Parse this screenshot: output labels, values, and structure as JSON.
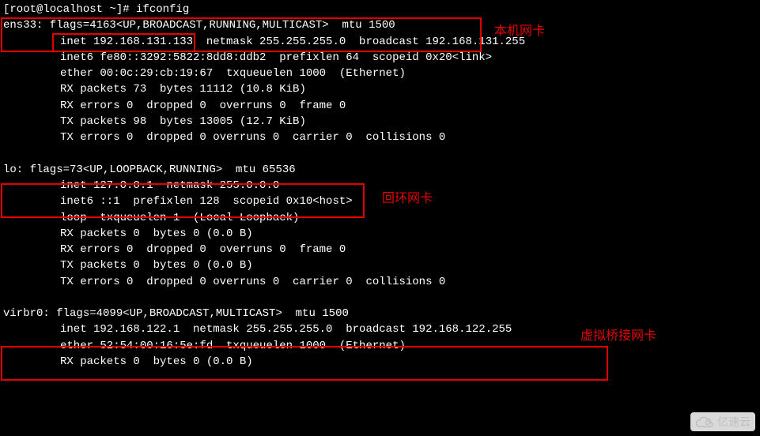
{
  "prompt": "[root@localhost ~]# ifconfig",
  "annotations": {
    "host_nic": "本机网卡",
    "loopback_nic": "回环网卡",
    "virtual_bridge_nic": "虚拟桥接网卡"
  },
  "ens33": {
    "header": "ens33: flags=4163<UP,BROADCAST,RUNNING,MULTICAST>  mtu 1500",
    "inet": "inet 192.168.131.133  netmask 255.255.255.0  broadcast 192.168.131.255",
    "inet6": "inet6 fe80::3292:5822:8dd8:ddb2  prefixlen 64  scopeid 0x20<link>",
    "ether": "ether 00:0c:29:cb:19:67  txqueuelen 1000  (Ethernet)",
    "rx_packets": "RX packets 73  bytes 11112 (10.8 KiB)",
    "rx_errors": "RX errors 0  dropped 0  overruns 0  frame 0",
    "tx_packets": "TX packets 98  bytes 13005 (12.7 KiB)",
    "tx_errors": "TX errors 0  dropped 0 overruns 0  carrier 0  collisions 0"
  },
  "lo": {
    "header": "lo: flags=73<UP,LOOPBACK,RUNNING>  mtu 65536",
    "inet": "inet 127.0.0.1  netmask 255.0.0.0",
    "inet6": "inet6 ::1  prefixlen 128  scopeid 0x10<host>",
    "loop": "loop  txqueuelen 1  (Local Loopback)",
    "rx_packets": "RX packets 0  bytes 0 (0.0 B)",
    "rx_errors": "RX errors 0  dropped 0  overruns 0  frame 0",
    "tx_packets": "TX packets 0  bytes 0 (0.0 B)",
    "tx_errors": "TX errors 0  dropped 0 overruns 0  carrier 0  collisions 0"
  },
  "virbr0": {
    "header": "virbr0: flags=4099<UP,BROADCAST,MULTICAST>  mtu 1500",
    "inet": "inet 192.168.122.1  netmask 255.255.255.0  broadcast 192.168.122.255",
    "ether": "ether 52:54:00:16:5e:fd  txqueuelen 1000  (Ethernet)",
    "rx_packets": "RX packets 0  bytes 0 (0.0 B)"
  },
  "watermark": "亿速云"
}
